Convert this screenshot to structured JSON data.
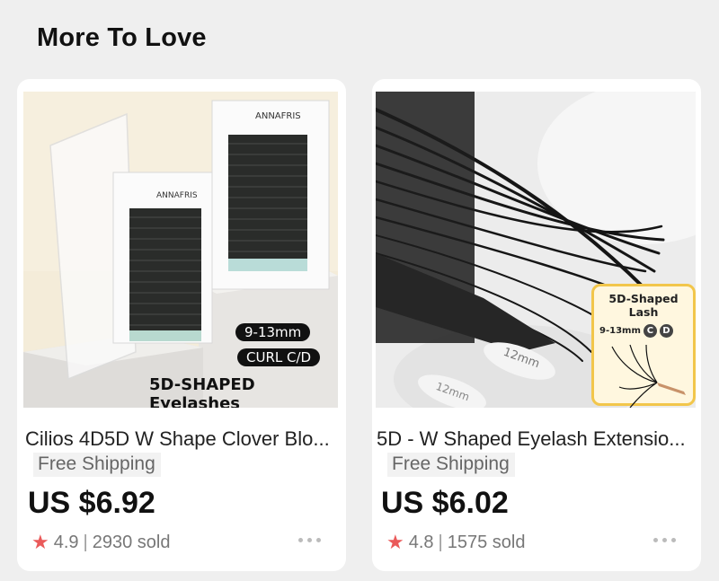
{
  "section": {
    "title": "More To Love"
  },
  "products": [
    {
      "title": "Cilios 4D5D W Shape Clover Blo...",
      "shipping": "Free Shipping",
      "price": "US $6.92",
      "rating": "4.9",
      "sold": "2930 sold",
      "image": {
        "brand": "ANNAFRIS",
        "length_badge": "9-13mm",
        "curl_badge": "CURL C/D",
        "caption": "5D-SHAPED Eyelashes"
      }
    },
    {
      "title": "5D - W Shaped Eyelash Extensio...",
      "shipping": "Free Shipping",
      "price": "US $6.02",
      "rating": "4.8",
      "sold": "1575 sold",
      "image": {
        "inset_title": "5D-Shaped Lash",
        "inset_length": "9-13mm",
        "inset_curl_c": "C",
        "inset_curl_d": "D",
        "tray_label_1": "12mm",
        "tray_label_2": "12mm"
      }
    }
  ],
  "colors": {
    "star": "#ea5a5a",
    "background": "#efefef",
    "card": "#ffffff"
  },
  "icons": {
    "rating": "star-icon",
    "more": "more-dots-icon"
  }
}
